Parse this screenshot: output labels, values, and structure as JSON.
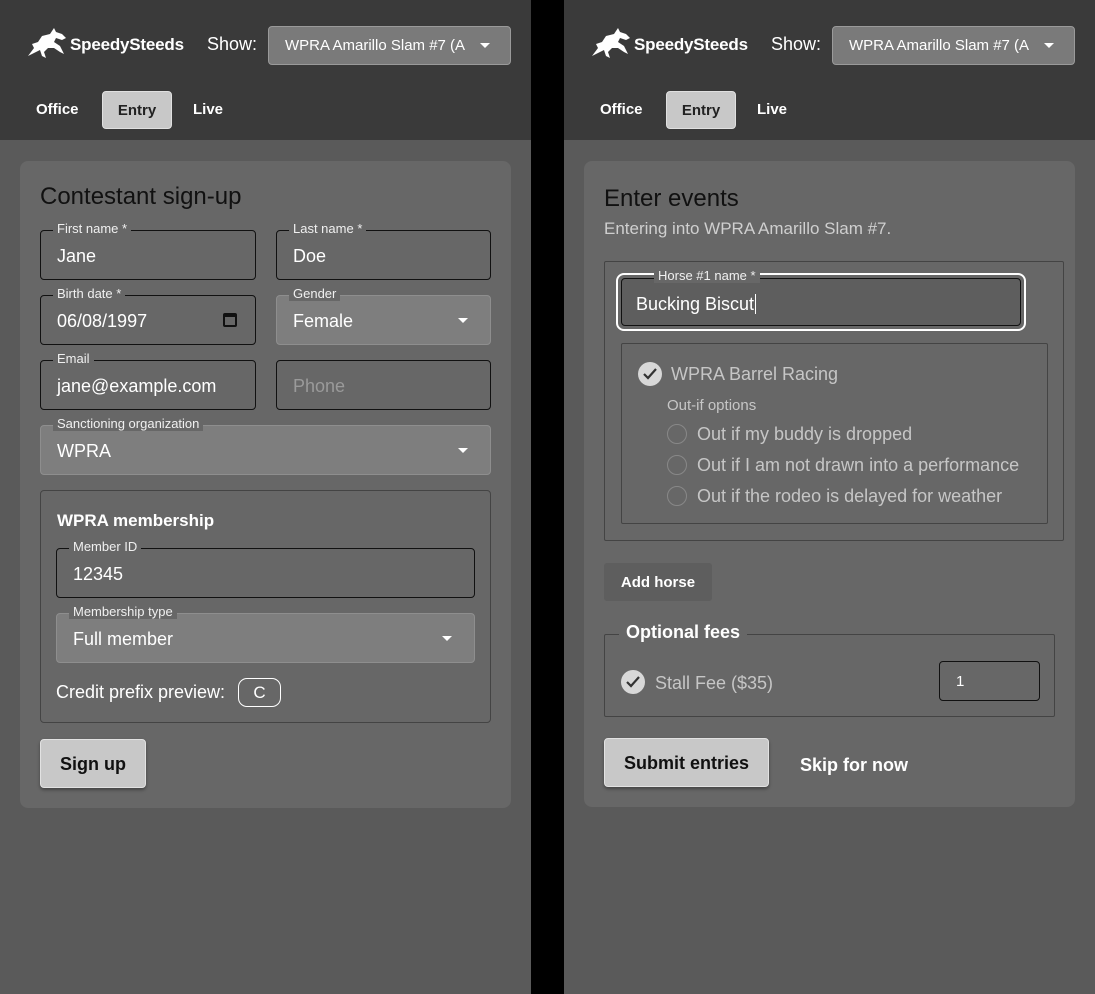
{
  "app": {
    "brand": "SpeedySteeds",
    "show_label": "Show:",
    "show_value": "WPRA Amarillo Slam #7 (A"
  },
  "nav": {
    "office": "Office",
    "entry": "Entry",
    "live": "Live"
  },
  "signup": {
    "title": "Contestant sign-up",
    "first_name": {
      "label": "First name *",
      "value": "Jane"
    },
    "last_name": {
      "label": "Last name *",
      "value": "Doe"
    },
    "birth_date": {
      "label": "Birth date *",
      "value": "06/08/1997"
    },
    "gender": {
      "label": "Gender",
      "value": "Female"
    },
    "email": {
      "label": "Email",
      "value": "jane@example.com"
    },
    "phone": {
      "placeholder": "Phone"
    },
    "org": {
      "label": "Sanctioning organization",
      "value": "WPRA"
    },
    "membership": {
      "title": "WPRA membership",
      "member_id": {
        "label": "Member ID",
        "value": "12345"
      },
      "type": {
        "label": "Membership type",
        "value": "Full member"
      },
      "prefix_label": "Credit prefix preview:",
      "prefix_value": "C"
    },
    "submit": "Sign up"
  },
  "events": {
    "title": "Enter events",
    "subtitle": "Entering into WPRA Amarillo Slam #7.",
    "horse_name": {
      "label": "Horse #1 name *",
      "value": "Bucking Biscut"
    },
    "event": "WPRA Barrel Racing",
    "outif_label": "Out-if options",
    "outif_options": [
      "Out if my buddy is dropped",
      "Out if I am not drawn into a performance",
      "Out if the rodeo is delayed for weather"
    ],
    "add_horse": "Add horse",
    "fees_title": "Optional fees",
    "stall_fee": "Stall Fee ($35)",
    "stall_qty": "1",
    "submit": "Submit entries",
    "skip": "Skip for now"
  },
  "colors": {
    "topbar": "#3a3a3a",
    "panel": "#5a5a5a",
    "card": "#676767",
    "button": "#c8c8c8"
  }
}
